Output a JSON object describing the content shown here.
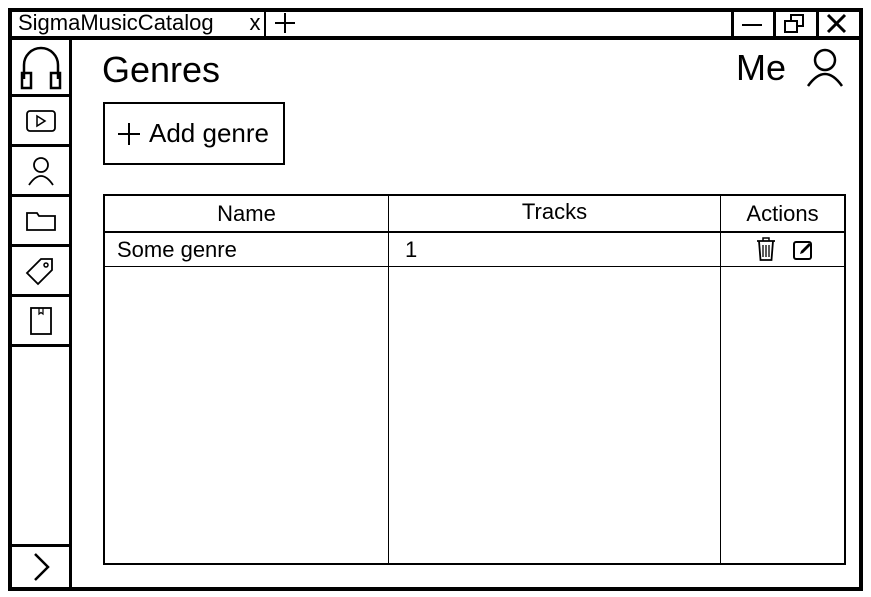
{
  "window": {
    "tab_title": "SigmaMusicCatalog",
    "tab_close_label": "x"
  },
  "header": {
    "title": "Genres",
    "user_name": "Me"
  },
  "sidebar": {
    "items": [
      {
        "icon": "headphones-icon"
      },
      {
        "icon": "play-icon"
      },
      {
        "icon": "user-icon"
      },
      {
        "icon": "folder-icon"
      },
      {
        "icon": "tag-icon"
      },
      {
        "icon": "book-icon"
      }
    ],
    "expand_icon": "chevron-right-icon"
  },
  "toolbar": {
    "add_label": "Add genre"
  },
  "table": {
    "columns": [
      "Name",
      "Tracks",
      "Actions"
    ],
    "rows": [
      {
        "name": "Some genre",
        "tracks": "1",
        "actions": [
          "delete-icon",
          "edit-icon"
        ]
      }
    ]
  }
}
